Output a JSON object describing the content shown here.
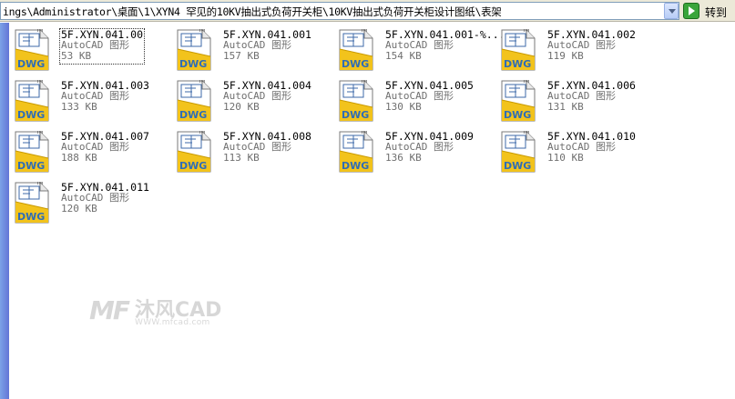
{
  "address_bar": {
    "path": "ings\\Administrator\\桌面\\1\\XYN4 罕见的10KV抽出式负荷开关柜\\10KV抽出式负荷开关柜设计图纸\\表架",
    "go_label": "转到"
  },
  "files": [
    {
      "name": "5F.XYN.041.00",
      "type": "AutoCAD 图形",
      "size": "53 KB",
      "icon_label": "DWG"
    },
    {
      "name": "5F.XYN.041.001",
      "type": "AutoCAD 图形",
      "size": "157 KB",
      "icon_label": "DWG"
    },
    {
      "name": "5F.XYN.041.001-%...",
      "type": "AutoCAD 图形",
      "size": "154 KB",
      "icon_label": "DWG"
    },
    {
      "name": "5F.XYN.041.002",
      "type": "AutoCAD 图形",
      "size": "119 KB",
      "icon_label": "DWG"
    },
    {
      "name": "5F.XYN.041.003",
      "type": "AutoCAD 图形",
      "size": "133 KB",
      "icon_label": "DWG"
    },
    {
      "name": "5F.XYN.041.004",
      "type": "AutoCAD 图形",
      "size": "120 KB",
      "icon_label": "DWG"
    },
    {
      "name": "5F.XYN.041.005",
      "type": "AutoCAD 图形",
      "size": "130 KB",
      "icon_label": "DWG"
    },
    {
      "name": "5F.XYN.041.006",
      "type": "AutoCAD 图形",
      "size": "131 KB",
      "icon_label": "DWG"
    },
    {
      "name": "5F.XYN.041.007",
      "type": "AutoCAD 图形",
      "size": "188 KB",
      "icon_label": "DWG"
    },
    {
      "name": "5F.XYN.041.008",
      "type": "AutoCAD 图形",
      "size": "113 KB",
      "icon_label": "DWG"
    },
    {
      "name": "5F.XYN.041.009",
      "type": "AutoCAD 图形",
      "size": "136 KB",
      "icon_label": "DWG"
    },
    {
      "name": "5F.XYN.041.010",
      "type": "AutoCAD 图形",
      "size": "110 KB",
      "icon_label": "DWG"
    },
    {
      "name": "5F.XYN.041.011",
      "type": "AutoCAD 图形",
      "size": "120 KB",
      "icon_label": "DWG"
    }
  ],
  "watermark": {
    "mark": "MF",
    "title": "沐风CAD",
    "url": "WWW.mfcad.com"
  },
  "colors": {
    "icon_gold": "#f2c31c",
    "icon_blue": "#2f6db6",
    "task_pane": "#6f8fe0"
  }
}
